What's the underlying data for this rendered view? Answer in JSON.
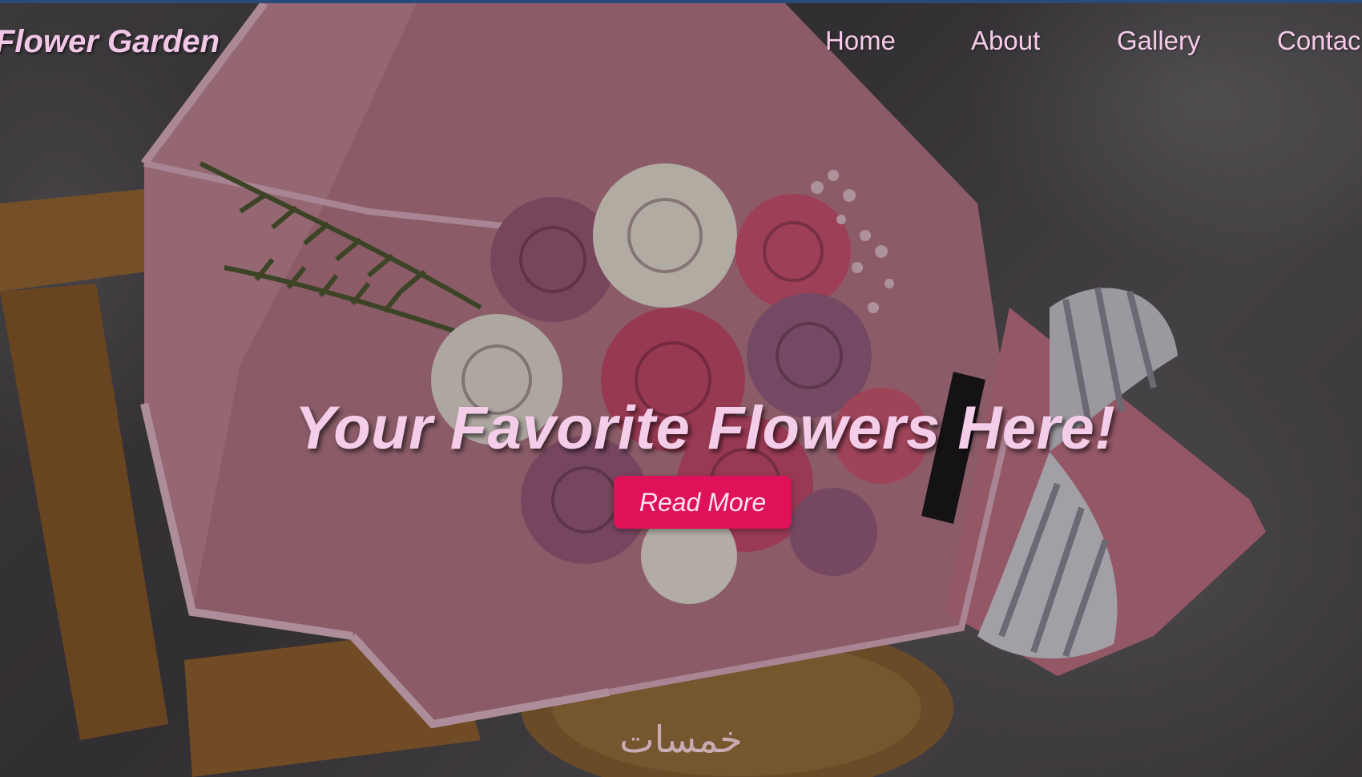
{
  "brand": {
    "name": "Flower Garden"
  },
  "nav": {
    "items": [
      {
        "label": "Home"
      },
      {
        "label": "About"
      },
      {
        "label": "Gallery"
      },
      {
        "label": "Contac"
      }
    ]
  },
  "hero": {
    "headline": "Your Favorite Flowers Here!",
    "button_label": "Read More",
    "image_subject": "bouquet of pink and white roses wrapped in pink paper with striped ribbon on a wooden stool"
  },
  "watermark": {
    "text": "خمسات"
  },
  "colors": {
    "accent": "#df1158",
    "text_pink": "#f4cde9",
    "top_strip": "#2a4a7a"
  }
}
